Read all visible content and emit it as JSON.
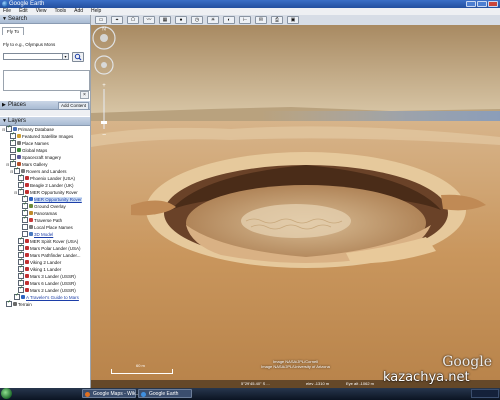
{
  "window": {
    "title": "Google Earth"
  },
  "menu": [
    "File",
    "Edit",
    "View",
    "Tools",
    "Add",
    "Help"
  ],
  "search": {
    "header": "Search",
    "tab": "Fly To",
    "label": "Fly to e.g., Olympus Mons",
    "input_value": "",
    "close_glyph": "×"
  },
  "places": {
    "header": "Places",
    "add_content": "Add Content"
  },
  "layers": {
    "header": "Layers",
    "items": [
      {
        "label": "Primary Database",
        "checked": true,
        "icon_color": "#4a6fb5",
        "link": false
      },
      {
        "label": "Featured Satellite Images",
        "checked": true,
        "icon_color": "#d0a030",
        "link": false
      },
      {
        "label": "Place Names",
        "checked": true,
        "icon_color": "#7c7c7c",
        "link": false
      },
      {
        "label": "Global Maps",
        "checked": false,
        "icon_color": "#3b8a3b",
        "link": false
      },
      {
        "label": "Spacecraft Imagery",
        "checked": false,
        "icon_color": "#5a5a9a",
        "link": false
      },
      {
        "label": "Mars Gallery",
        "checked": true,
        "icon_color": "#b5522e",
        "link": false
      },
      {
        "label": "Rovers and Landers",
        "checked": true,
        "icon_color": "#7a7a7a",
        "link": false
      },
      {
        "label": "Phoenix Lander (USA)",
        "checked": true,
        "icon_color": "#c03030",
        "link": false
      },
      {
        "label": "Beagle 2 Lander (UK)",
        "checked": true,
        "icon_color": "#c03030",
        "link": false
      },
      {
        "label": "MER Opportunity Rover",
        "checked": true,
        "icon_color": "#c03030",
        "link": false
      },
      {
        "label": "MER Opportunity Rover",
        "checked": true,
        "icon_color": "#2e62c0",
        "link": true,
        "selected": true
      },
      {
        "label": "Ground Overlay",
        "checked": true,
        "icon_color": "#6a8a3a",
        "link": false
      },
      {
        "label": "Panoramas",
        "checked": true,
        "icon_color": "#c08a2a",
        "link": false
      },
      {
        "label": "Traverse Path",
        "checked": true,
        "icon_color": "#c83a3a",
        "link": false
      },
      {
        "label": "Local Place Names",
        "checked": false,
        "icon_color": "#7c7c7c",
        "link": false
      },
      {
        "label": "3D Model",
        "checked": false,
        "icon_color": "#4a7ac0",
        "link": true
      },
      {
        "label": "MER Spirit Rover (USA)",
        "checked": true,
        "icon_color": "#c03030",
        "link": false
      },
      {
        "label": "Mars Polar Lander (USA)",
        "checked": true,
        "icon_color": "#c03030",
        "link": false
      },
      {
        "label": "Mars Pathfinder Lander...",
        "checked": true,
        "icon_color": "#c03030",
        "link": false
      },
      {
        "label": "Viking 2 Lander",
        "checked": true,
        "icon_color": "#c03030",
        "link": false
      },
      {
        "label": "Viking 1 Lander",
        "checked": true,
        "icon_color": "#c03030",
        "link": false
      },
      {
        "label": "Mars 3 Lander (USSR)",
        "checked": true,
        "icon_color": "#c03030",
        "link": false
      },
      {
        "label": "Mars 6 Lander (USSR)",
        "checked": true,
        "icon_color": "#c03030",
        "link": false
      },
      {
        "label": "Mars 2 Lander (USSR)",
        "checked": true,
        "icon_color": "#c03030",
        "link": false
      },
      {
        "label": "A Traveler's Guide to Mars",
        "checked": true,
        "icon_color": "#2e62c0",
        "link": true
      },
      {
        "label": "Terrain",
        "checked": true,
        "icon_color": "#6a6a6a",
        "link": false
      }
    ]
  },
  "toolbar": {
    "buttons": [
      {
        "name": "sidebar-toggle-icon",
        "glyph": "▭"
      },
      {
        "name": "placemark-icon",
        "glyph": "⌖"
      },
      {
        "name": "polygon-icon",
        "glyph": "⬠"
      },
      {
        "name": "path-icon",
        "glyph": "〰"
      },
      {
        "name": "image-overlay-icon",
        "glyph": "▦"
      },
      {
        "name": "record-tour-icon",
        "glyph": "●"
      },
      {
        "name": "historical-imagery-icon",
        "glyph": "◷"
      },
      {
        "name": "sunlight-icon",
        "glyph": "☀"
      },
      {
        "name": "planets-icon",
        "glyph": "◐"
      },
      {
        "name": "ruler-icon",
        "glyph": "⊢"
      },
      {
        "name": "email-icon",
        "glyph": "✉"
      },
      {
        "name": "print-icon",
        "glyph": "⎙"
      },
      {
        "name": "view-in-maps-icon",
        "glyph": "▣"
      }
    ]
  },
  "map": {
    "image_credit_1": "Image NASA/JPL/Cornell",
    "image_credit_2": "Image NASA/JPL/University of Arizona",
    "scale_label": "60 m",
    "google_logo": "Google",
    "status": {
      "date": "",
      "coords": "5°29'45.40\" S   ...",
      "elev": "elev  -1310 m",
      "eye": "Eye alt   -1062 m"
    }
  },
  "watermark": "kazachya.net",
  "taskbar": {
    "tasks": [
      {
        "label": "Google Maps - Wik...",
        "icon_color": "#e07020"
      },
      {
        "label": "Google Earth",
        "icon_color": "#3f8fe0"
      }
    ]
  },
  "colors": {
    "sky": "#c8b08a",
    "ground": "#c9945a",
    "crater_shadow": "#5a3a22",
    "accent": "#2e62c0"
  }
}
